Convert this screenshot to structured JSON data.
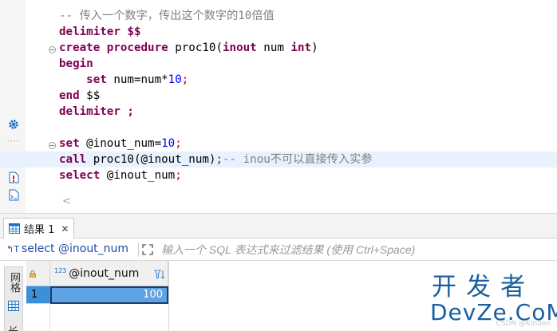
{
  "editor": {
    "lines": [
      [
        {
          "t": "-- 传入一个数字，传出这个数字的10倍值",
          "c": "cm"
        }
      ],
      [
        {
          "t": "delimiter $$",
          "c": "kw"
        }
      ],
      [
        {
          "t": "create",
          "c": "kw"
        },
        {
          "t": " "
        },
        {
          "t": "procedure",
          "c": "kw"
        },
        {
          "t": " proc10("
        },
        {
          "t": "inout",
          "c": "kw"
        },
        {
          "t": " num "
        },
        {
          "t": "int",
          "c": "kw"
        },
        {
          "t": ")"
        }
      ],
      [
        {
          "t": "begin",
          "c": "kw"
        }
      ],
      [
        {
          "t": "    "
        },
        {
          "t": "set",
          "c": "kw"
        },
        {
          "t": " num=num*"
        },
        {
          "t": "10",
          "c": "num"
        },
        {
          "t": ";",
          "c": "red"
        }
      ],
      [
        {
          "t": "end",
          "c": "kw"
        },
        {
          "t": " $$"
        }
      ],
      [
        {
          "t": "delimiter ;",
          "c": "kw"
        }
      ],
      [
        {
          "t": ""
        }
      ],
      [
        {
          "t": "set",
          "c": "kw"
        },
        {
          "t": " @inout_num="
        },
        {
          "t": "10",
          "c": "num"
        },
        {
          "t": ";",
          "c": "red"
        }
      ],
      [
        {
          "t": "call",
          "c": "kw"
        },
        {
          "t": " proc10(@inout_num)"
        },
        {
          "t": ";",
          "c": "red"
        },
        {
          "t": "-- inou不可以直接传入实参",
          "c": "cm"
        }
      ],
      [
        {
          "t": "select",
          "c": "kw"
        },
        {
          "t": " @inout_num"
        },
        {
          "t": ";",
          "c": "red"
        }
      ]
    ],
    "highlighted_line": 9,
    "fold_lines": [
      2,
      8
    ]
  },
  "results": {
    "tab_label": "结果 1",
    "tab_close": "✕",
    "query_text": "select @inout_num",
    "filter_placeholder": "输入一个 SQL 表达式来过滤结果 (使用 Ctrl+Space)",
    "side_label": "网格",
    "side_label2": "长",
    "column_type": "123",
    "column_name": "@inout_num",
    "row_number": "1",
    "cell_value": "100"
  },
  "watermark": {
    "top": "开发者",
    "bottom": "DevZe.CoM",
    "faint": "CSDN @Kinden"
  },
  "colors": {
    "keyword": "#7f0055",
    "number": "#0000ff",
    "comment": "#808080",
    "selection": "#5fa3e3",
    "watermark": "#1a5fa0"
  }
}
